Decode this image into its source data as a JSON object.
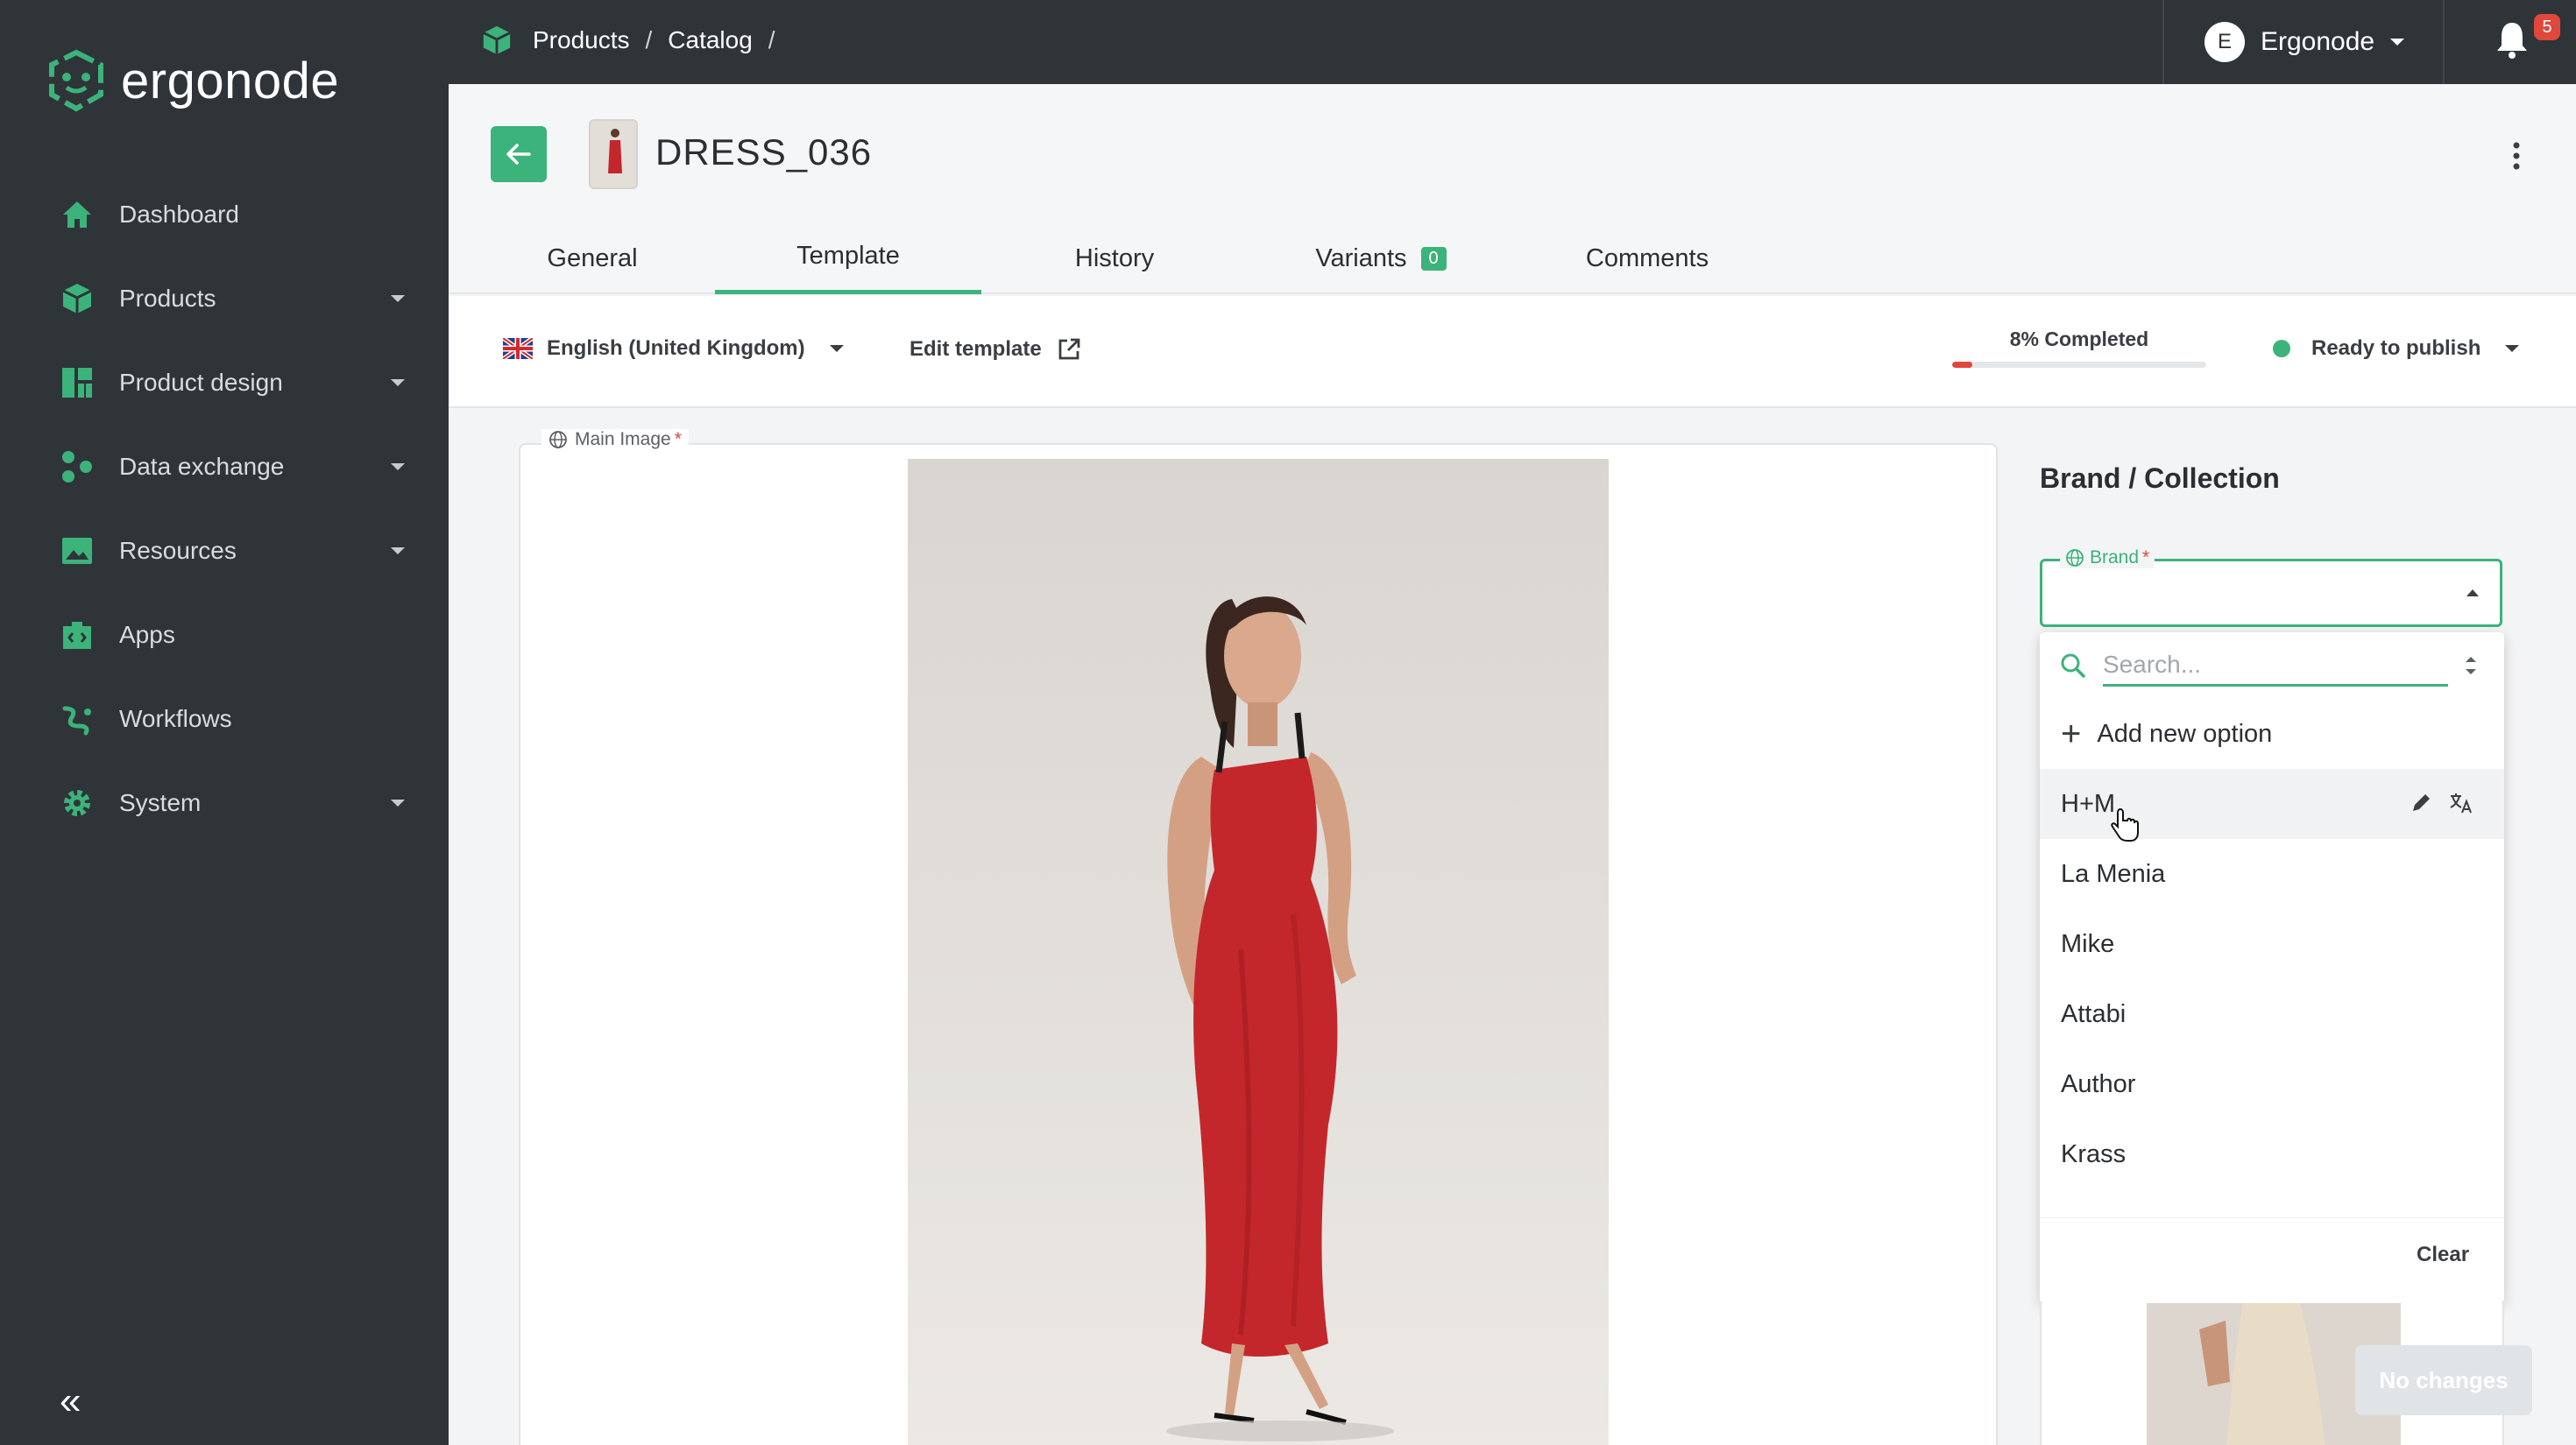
{
  "app": {
    "name": "ergonode"
  },
  "sidebar": {
    "items": [
      {
        "label": "Dashboard",
        "icon": "home-icon",
        "has_caret": false
      },
      {
        "label": "Products",
        "icon": "cube-icon",
        "has_caret": true
      },
      {
        "label": "Product design",
        "icon": "layout-icon",
        "has_caret": true
      },
      {
        "label": "Data exchange",
        "icon": "share-icon",
        "has_caret": true
      },
      {
        "label": "Resources",
        "icon": "image-icon",
        "has_caret": true
      },
      {
        "label": "Apps",
        "icon": "puzzle-icon",
        "has_caret": false
      },
      {
        "label": "Workflows",
        "icon": "workflow-icon",
        "has_caret": false
      },
      {
        "label": "System",
        "icon": "gear-icon",
        "has_caret": true
      }
    ],
    "collapse_glyph": "«"
  },
  "topbar": {
    "breadcrumb": [
      "Products",
      "Catalog"
    ],
    "separator": "/",
    "user": {
      "initial": "E",
      "name": "Ergonode"
    },
    "notifications_count": "5"
  },
  "product": {
    "title": "DRESS_036",
    "tabs": [
      {
        "label": "General",
        "active": false
      },
      {
        "label": "Template",
        "active": true
      },
      {
        "label": "History",
        "active": false
      },
      {
        "label": "Variants",
        "active": false,
        "count": "0"
      },
      {
        "label": "Comments",
        "active": false
      }
    ]
  },
  "toolbar": {
    "language": "English (United Kingdom)",
    "edit_template": "Edit template",
    "completion_label": "8% Completed",
    "completion_percent": 8,
    "status": "Ready to publish"
  },
  "main_image": {
    "label": "Main Image",
    "required_mark": "*"
  },
  "brand_section": {
    "title": "Brand / Collection",
    "brand_label": "Brand",
    "required_mark": "*",
    "search_placeholder": "Search...",
    "add_option": "Add new option",
    "options": [
      "H+M",
      "La Menia",
      "Mike",
      "Attabi",
      "Author",
      "Krass"
    ],
    "hovered_option": "H+M",
    "clear_label": "Clear"
  },
  "footer": {
    "no_changes": "No changes"
  },
  "colors": {
    "accent": "#3cb37a",
    "sidebar_bg": "#2f3439",
    "danger": "#e0473d",
    "dress": "#c3272c"
  }
}
